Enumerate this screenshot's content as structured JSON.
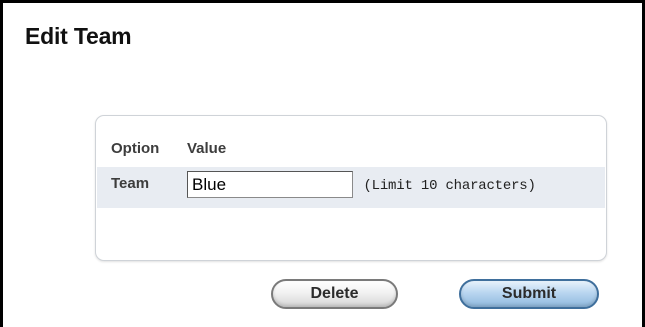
{
  "page": {
    "title": "Edit Team"
  },
  "form": {
    "headers": {
      "option": "Option",
      "value": "Value"
    },
    "fields": [
      {
        "label": "Team",
        "value": "Blue",
        "hint": "(Limit 10 characters)"
      }
    ]
  },
  "actions": {
    "delete_label": "Delete",
    "submit_label": "Submit"
  },
  "colors": {
    "row_background": "#e8ecf2",
    "submit_button": "#b9d6f0",
    "delete_button": "#f2f2f2"
  }
}
